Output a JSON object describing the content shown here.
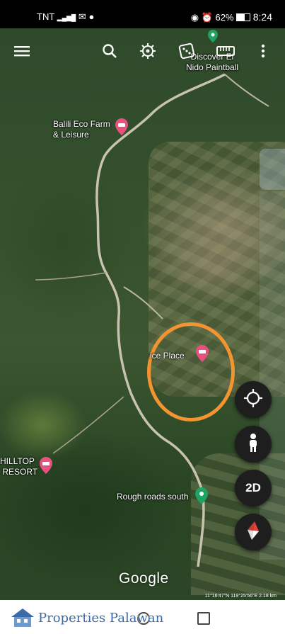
{
  "status_bar": {
    "carrier": "TNT",
    "battery": "62%",
    "time": "8:24"
  },
  "toolbar": {
    "icons": [
      "menu-icon",
      "search-icon",
      "voyager-icon",
      "dice-icon",
      "ruler-icon",
      "more-icon"
    ]
  },
  "places": {
    "discover": "Discover El\nNido Paintball",
    "balili": "Balili Eco Farm\n& Leisure",
    "nice_place": "ice Place",
    "hilltop": "HILLTOP\n RESORT",
    "rough_roads": "Rough roads south"
  },
  "controls": {
    "view_mode": "2D"
  },
  "footer": {
    "logo": "Google",
    "coordinates": "11°16'47\"N 119°25'56\"E 2.18 km"
  },
  "watermark": "Properties Palawan",
  "colors": {
    "pin_pink": "#e8517e",
    "pin_green": "#1ea362",
    "highlight_ring": "#f39431",
    "compass_red": "#e2453c"
  }
}
